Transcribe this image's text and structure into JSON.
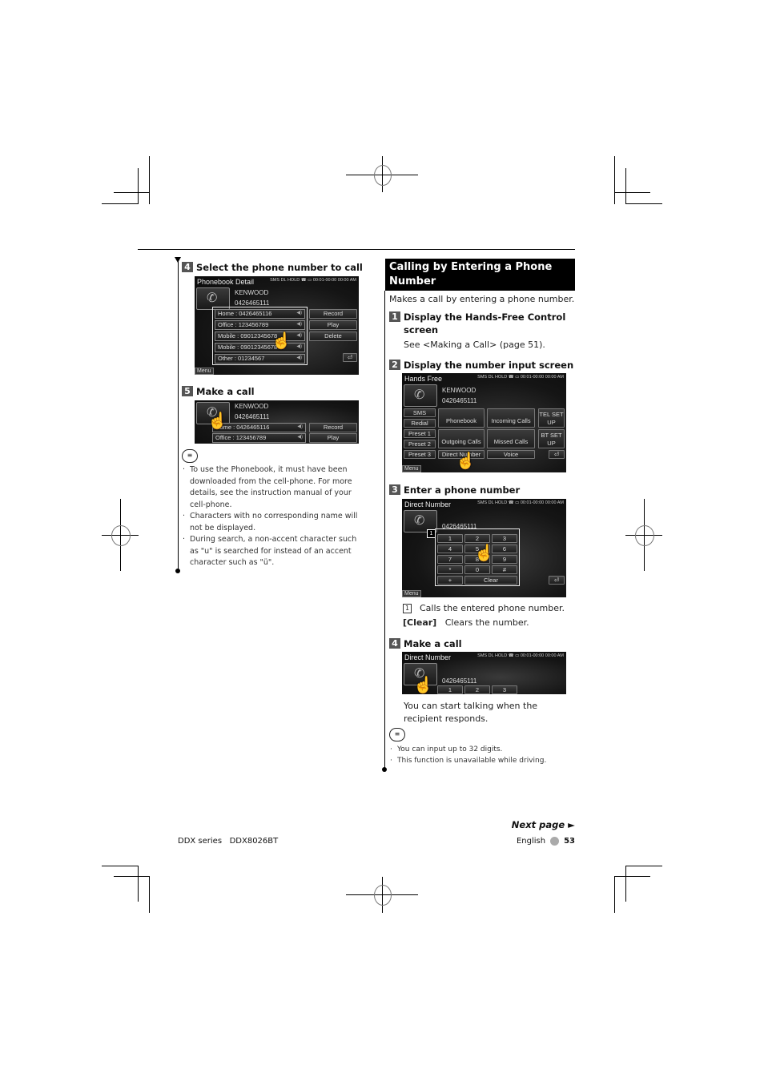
{
  "left": {
    "step4": {
      "num": "4",
      "title": "Select the phone number to call"
    },
    "screen_detail": {
      "title": "Phonebook Detail",
      "name": "KENWOOD",
      "number": "0426465111",
      "entries": [
        "Home : 0426465116",
        "Office : 123456789",
        "Mobile : 09012345678",
        "Mobile : 09012345678",
        "Other : 01234567"
      ],
      "buttons": [
        "Record",
        "Play",
        "Delete"
      ],
      "menu": "Menu",
      "status_top": "SMS DL HOLD",
      "time": "00:01-00:00 00:00 AM"
    },
    "step5": {
      "num": "5",
      "title": "Make a call"
    },
    "screen_call": {
      "name": "KENWOOD",
      "number": "0426465111",
      "entries": [
        "Home : 0426465116",
        "Office : 123456789"
      ],
      "buttons": [
        "Record",
        "Play"
      ]
    },
    "notes": [
      "To use the Phonebook, it must have been downloaded from the cell-phone. For more details, see the instruction manual of your cell-phone.",
      "Characters with no corresponding name will not be displayed.",
      "During search, a non-accent character such as \"u\" is searched for instead of an accent character such as \"ü\"."
    ]
  },
  "right": {
    "section_title": "Calling by Entering a Phone Number",
    "intro": "Makes a call by entering a phone number.",
    "step1": {
      "num": "1",
      "title": "Display the Hands-Free Control screen",
      "text": "See <Making a Call> (page 51)."
    },
    "step2": {
      "num": "2",
      "title": "Display the number input screen"
    },
    "screen_handsfree": {
      "title": "Hands Free",
      "name": "KENWOOD",
      "number": "0426465111",
      "left_buttons": [
        "SMS",
        "Redial",
        "Preset 1",
        "Preset 2",
        "Preset 3"
      ],
      "main_buttons": [
        "Phonebook",
        "Incoming Calls",
        "Outgoing Calls",
        "Missed Calls",
        "Direct Number",
        "Voice"
      ],
      "right_buttons": [
        "TEL SET UP",
        "BT SET UP"
      ],
      "menu": "Menu"
    },
    "step3": {
      "num": "3",
      "title": "Enter a phone number"
    },
    "screen_direct": {
      "title": "Direct Number",
      "number": "0426465111",
      "keys": [
        "1",
        "2",
        "3",
        "4",
        "5",
        "6",
        "7",
        "8",
        "9",
        "*",
        "0",
        "#",
        "+"
      ],
      "clear": "Clear",
      "callout": "1",
      "menu": "Menu"
    },
    "legend": [
      {
        "key": "1",
        "text": "Calls the entered phone number."
      },
      {
        "key": "[Clear]",
        "text": "Clears the number."
      }
    ],
    "step4": {
      "num": "4",
      "title": "Make a call"
    },
    "screen_direct2": {
      "title": "Direct Number",
      "number": "0426465111",
      "keys": [
        "1",
        "2",
        "3"
      ]
    },
    "step4_text": "You can start talking when the recipient responds.",
    "notes": [
      "You can input up to 32 digits.",
      "This function is unavailable while driving."
    ]
  },
  "footer": {
    "next_page": "Next page ►",
    "series": "DDX series   DDX8026BT",
    "language": "English",
    "page_number": "53"
  }
}
